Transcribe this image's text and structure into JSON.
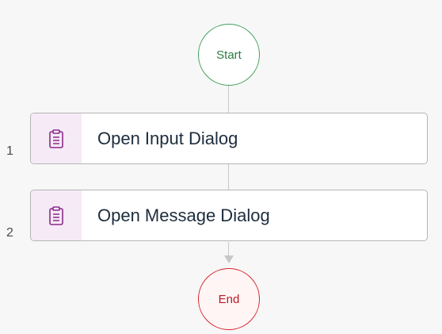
{
  "process": {
    "start_label": "Start",
    "end_label": "End",
    "steps": [
      {
        "number": "1",
        "label": "Open Input Dialog",
        "icon": "clipboard-icon"
      },
      {
        "number": "2",
        "label": "Open Message Dialog",
        "icon": "clipboard-icon"
      }
    ]
  },
  "colors": {
    "start": "#44a05a",
    "end": "#d8262f",
    "icon_accent": "#8b2a8b",
    "icon_bg": "#f5eaf5"
  }
}
